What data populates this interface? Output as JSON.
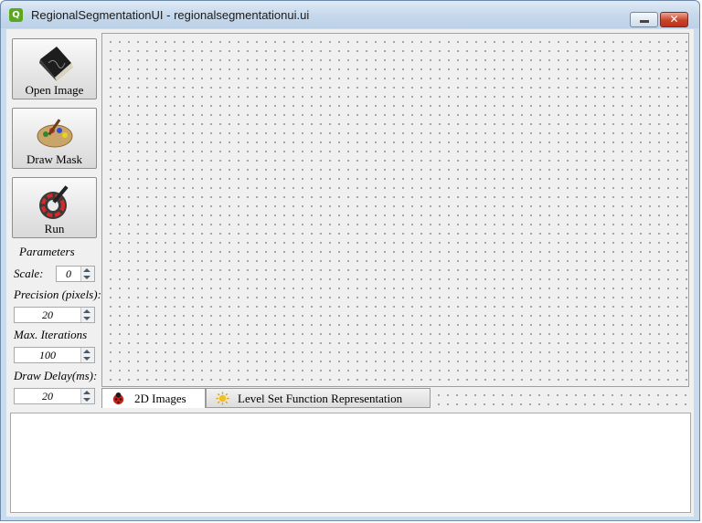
{
  "window": {
    "title": "RegionalSegmentationUI - regionalsegmentationui.ui",
    "app_icon": "qt-icon",
    "close_glyph": "✕"
  },
  "toolbar": {
    "open_image_label": "Open Image",
    "draw_mask_label": "Draw Mask",
    "run_label": "Run"
  },
  "parameters": {
    "heading": "Parameters",
    "scale_label": "Scale:",
    "scale_value": "0",
    "precision_label": "Precision (pixels):",
    "precision_value": "20",
    "max_iterations_label": "Max. Iterations",
    "max_iterations_value": "100",
    "draw_delay_label": "Draw Delay(ms):",
    "draw_delay_value": "20"
  },
  "tabs": [
    {
      "label": "2D Images",
      "icon": "ladybug-icon",
      "active": true
    },
    {
      "label": "Level Set Function Representation",
      "icon": "sun-icon",
      "active": false
    }
  ],
  "colors": {
    "title_bar": "#c7d9ec",
    "close_button": "#c9432b",
    "panel_background": "#f0f0f0"
  }
}
